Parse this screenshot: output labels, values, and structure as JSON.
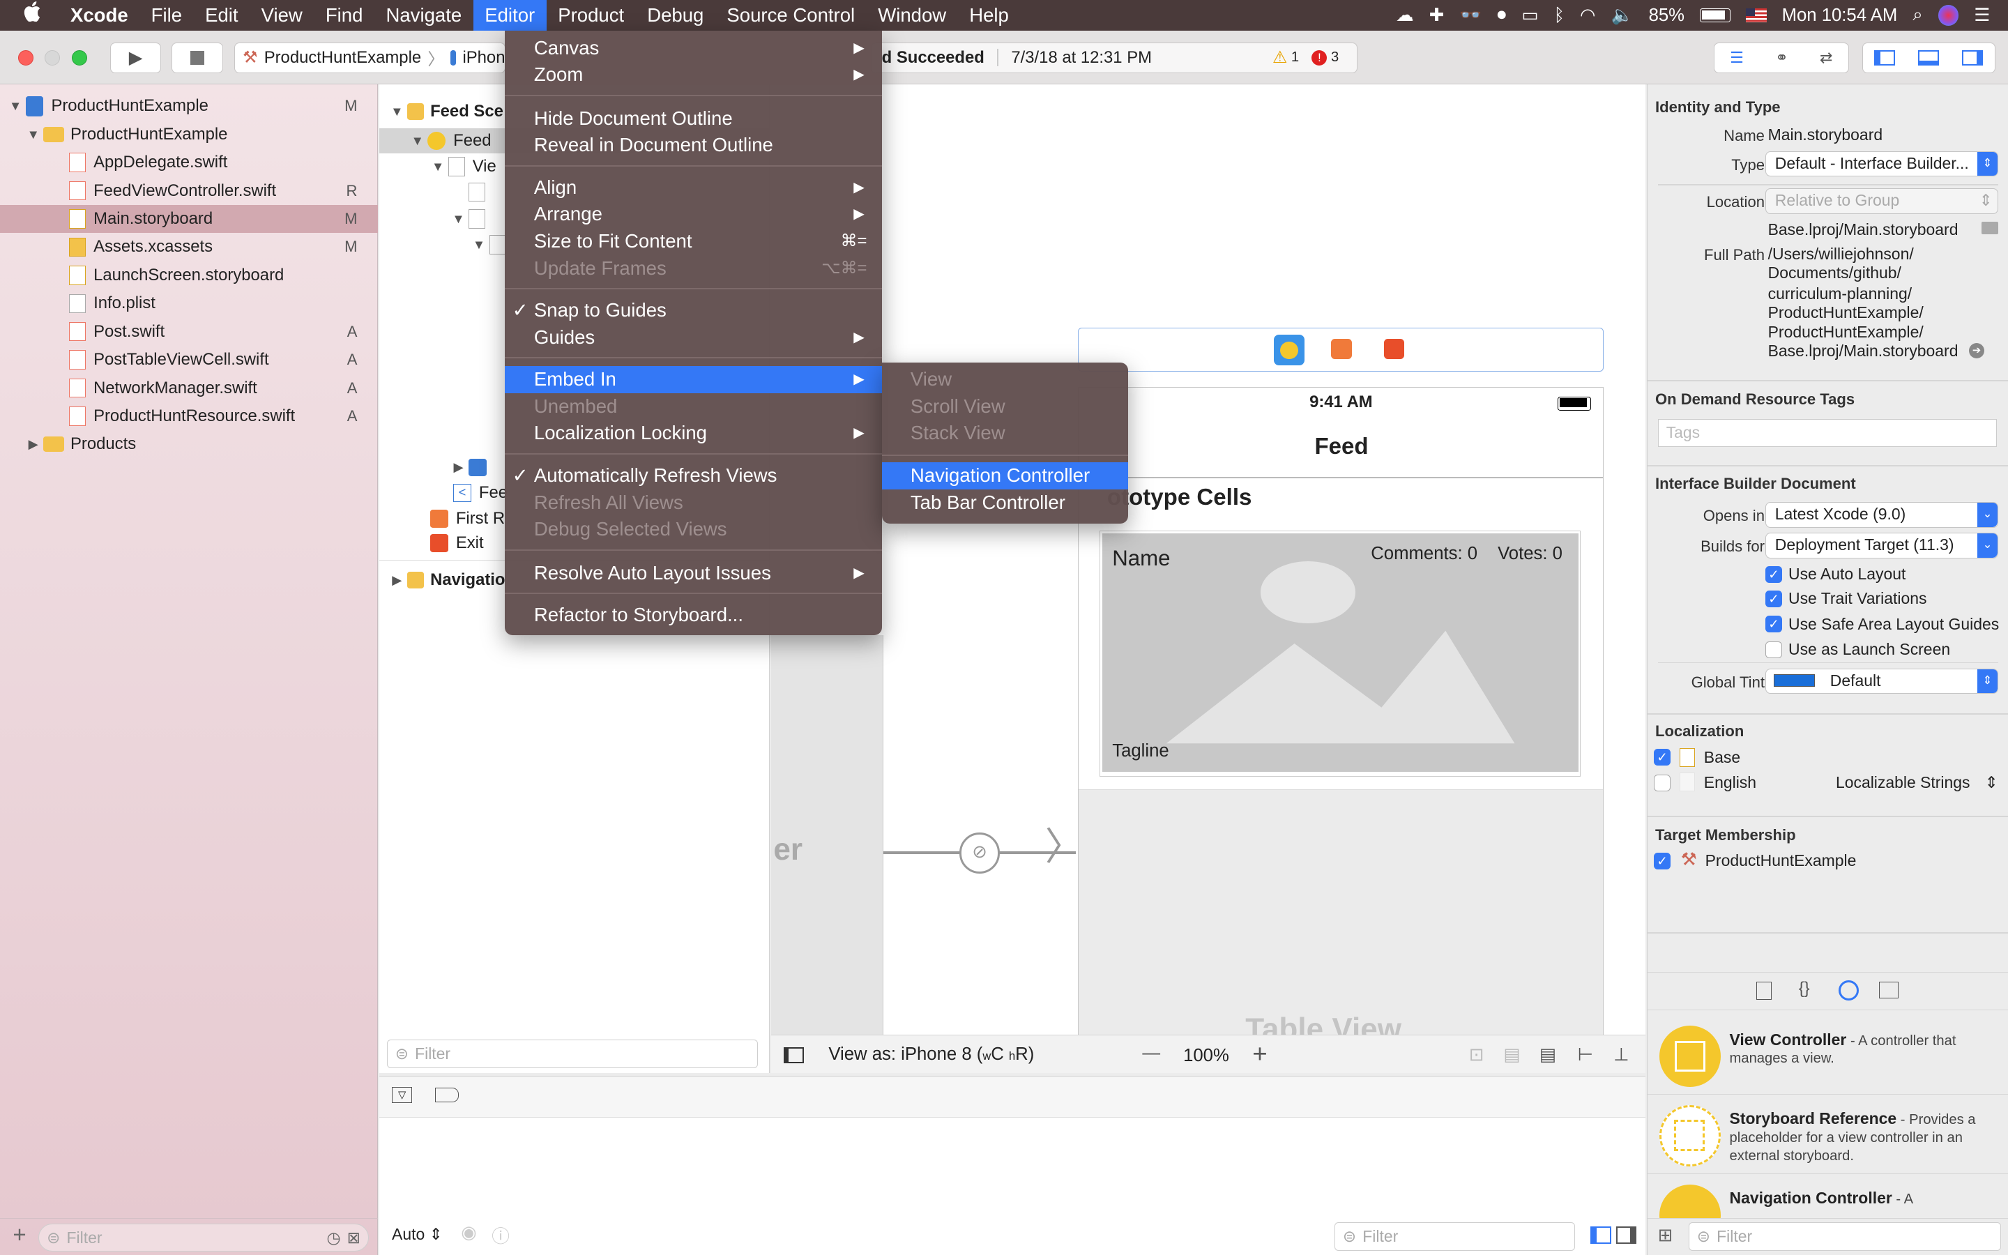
{
  "menubar": {
    "apple": "",
    "items": [
      "Xcode",
      "File",
      "Edit",
      "View",
      "Find",
      "Navigate",
      "Editor",
      "Product",
      "Debug",
      "Source Control",
      "Window",
      "Help"
    ],
    "active": "Editor",
    "battery": "85%",
    "clock": "Mon 10:54 AM"
  },
  "toolbar": {
    "scheme": "ProductHuntExample",
    "device": "iPhon",
    "status": "d Succeeded",
    "timestamp": "7/3/18 at 12:31 PM",
    "warnings": "1",
    "errors": "3"
  },
  "navigator": {
    "rows": [
      {
        "label": "ProductHuntExample",
        "status": "M"
      },
      {
        "label": "ProductHuntExample",
        "status": ""
      },
      {
        "label": "AppDelegate.swift",
        "status": ""
      },
      {
        "label": "FeedViewController.swift",
        "status": "R"
      },
      {
        "label": "Main.storyboard",
        "status": "M"
      },
      {
        "label": "Assets.xcassets",
        "status": "M"
      },
      {
        "label": "LaunchScreen.storyboard",
        "status": ""
      },
      {
        "label": "Info.plist",
        "status": ""
      },
      {
        "label": "Post.swift",
        "status": "A"
      },
      {
        "label": "PostTableViewCell.swift",
        "status": "A"
      },
      {
        "label": "NetworkManager.swift",
        "status": "A"
      },
      {
        "label": "ProductHuntResource.swift",
        "status": "A"
      },
      {
        "label": "Products",
        "status": ""
      }
    ],
    "filter_placeholder": "Filter"
  },
  "outline": {
    "rows": [
      "Feed Sce",
      "Feed",
      "Vie",
      "Fee",
      "First R",
      "Exit",
      "Navigatio"
    ],
    "filter_placeholder": "Filter"
  },
  "editor_menu": {
    "items": [
      {
        "label": "Canvas",
        "submenu": "▶"
      },
      {
        "label": "Zoom",
        "submenu": "▶"
      },
      {
        "label": "Hide Document Outline"
      },
      {
        "label": "Reveal in Document Outline"
      },
      {
        "label": "Align",
        "submenu": "▶"
      },
      {
        "label": "Arrange",
        "submenu": "▶"
      },
      {
        "label": "Size to Fit Content",
        "shortcut": "⌘="
      },
      {
        "label": "Update Frames",
        "shortcut": "⌥⌘="
      },
      {
        "label": "Snap to Guides",
        "check": "✓"
      },
      {
        "label": "Guides",
        "submenu": "▶"
      },
      {
        "label": "Embed In",
        "submenu": "▶"
      },
      {
        "label": "Unembed"
      },
      {
        "label": "Localization Locking",
        "submenu": "▶"
      },
      {
        "label": "Automatically Refresh Views",
        "check": "✓"
      },
      {
        "label": "Refresh All Views"
      },
      {
        "label": "Debug Selected Views"
      },
      {
        "label": "Resolve Auto Layout Issues",
        "submenu": "▶"
      },
      {
        "label": "Refactor to Storyboard..."
      }
    ]
  },
  "embed_submenu": {
    "items": [
      "View",
      "Scroll View",
      "Stack View",
      "Navigation Controller",
      "Tab Bar Controller"
    ]
  },
  "canvas": {
    "time": "9:41 AM",
    "nav_title": "Feed",
    "prototype": "ototype Cells",
    "cell_name": "Name",
    "cell_comments": "Comments: 0",
    "cell_votes": "Votes: 0",
    "cell_tagline": "Tagline",
    "table_view": "Table View",
    "left_label": "er",
    "view_as": "View as: iPhone 8 (",
    "view_as_w": "w",
    "view_as_c": "C",
    "view_as_h": "h",
    "view_as_r": "R)",
    "zoom_minus": "—",
    "zoom": "100%",
    "zoom_plus": "+"
  },
  "debug": {
    "auto": "Auto",
    "filter_placeholder": "Filter"
  },
  "inspector": {
    "identity_header": "Identity and Type",
    "name_label": "Name",
    "name_value": "Main.storyboard",
    "type_label": "Type",
    "type_value": "Default - Interface Builder...",
    "location_label": "Location",
    "location_value": "Relative to Group",
    "location_file": "Base.lproj/Main.storyboard",
    "fullpath_label": "Full Path",
    "fullpath_lines": [
      "/Users/williejohnson/",
      "Documents/github/",
      "curriculum-planning/",
      "ProductHuntExample/",
      "ProductHuntExample/",
      "Base.lproj/Main.storyboard"
    ],
    "ondemand_header": "On Demand Resource Tags",
    "tags_placeholder": "Tags",
    "ibdoc_header": "Interface Builder Document",
    "opens_label": "Opens in",
    "opens_value": "Latest Xcode (9.0)",
    "builds_label": "Builds for",
    "builds_value": "Deployment Target (11.3)",
    "checks": [
      {
        "label": "Use Auto Layout",
        "checked": true
      },
      {
        "label": "Use Trait Variations",
        "checked": true
      },
      {
        "label": "Use Safe Area Layout Guides",
        "checked": true
      },
      {
        "label": "Use as Launch Screen",
        "checked": false
      }
    ],
    "tint_label": "Global Tint",
    "tint_value": "Default",
    "localization_header": "Localization",
    "loc_base": "Base",
    "loc_english": "English",
    "loc_english_type": "Localizable Strings",
    "target_header": "Target Membership",
    "target_name": "ProductHuntExample",
    "library": [
      {
        "title": "View Controller",
        "desc": " - A controller that manages a view."
      },
      {
        "title": "Storyboard Reference",
        "desc": " - Provides a placeholder for a view controller in an external storyboard."
      },
      {
        "title": "Navigation Controller",
        "desc": " - A"
      }
    ],
    "filter_placeholder": "Filter"
  },
  "colors": {
    "accent": "#3478f6",
    "menubar": "#4a3a3a",
    "menu_bg": "#625050",
    "nav_selected": "#d2a9b0"
  }
}
